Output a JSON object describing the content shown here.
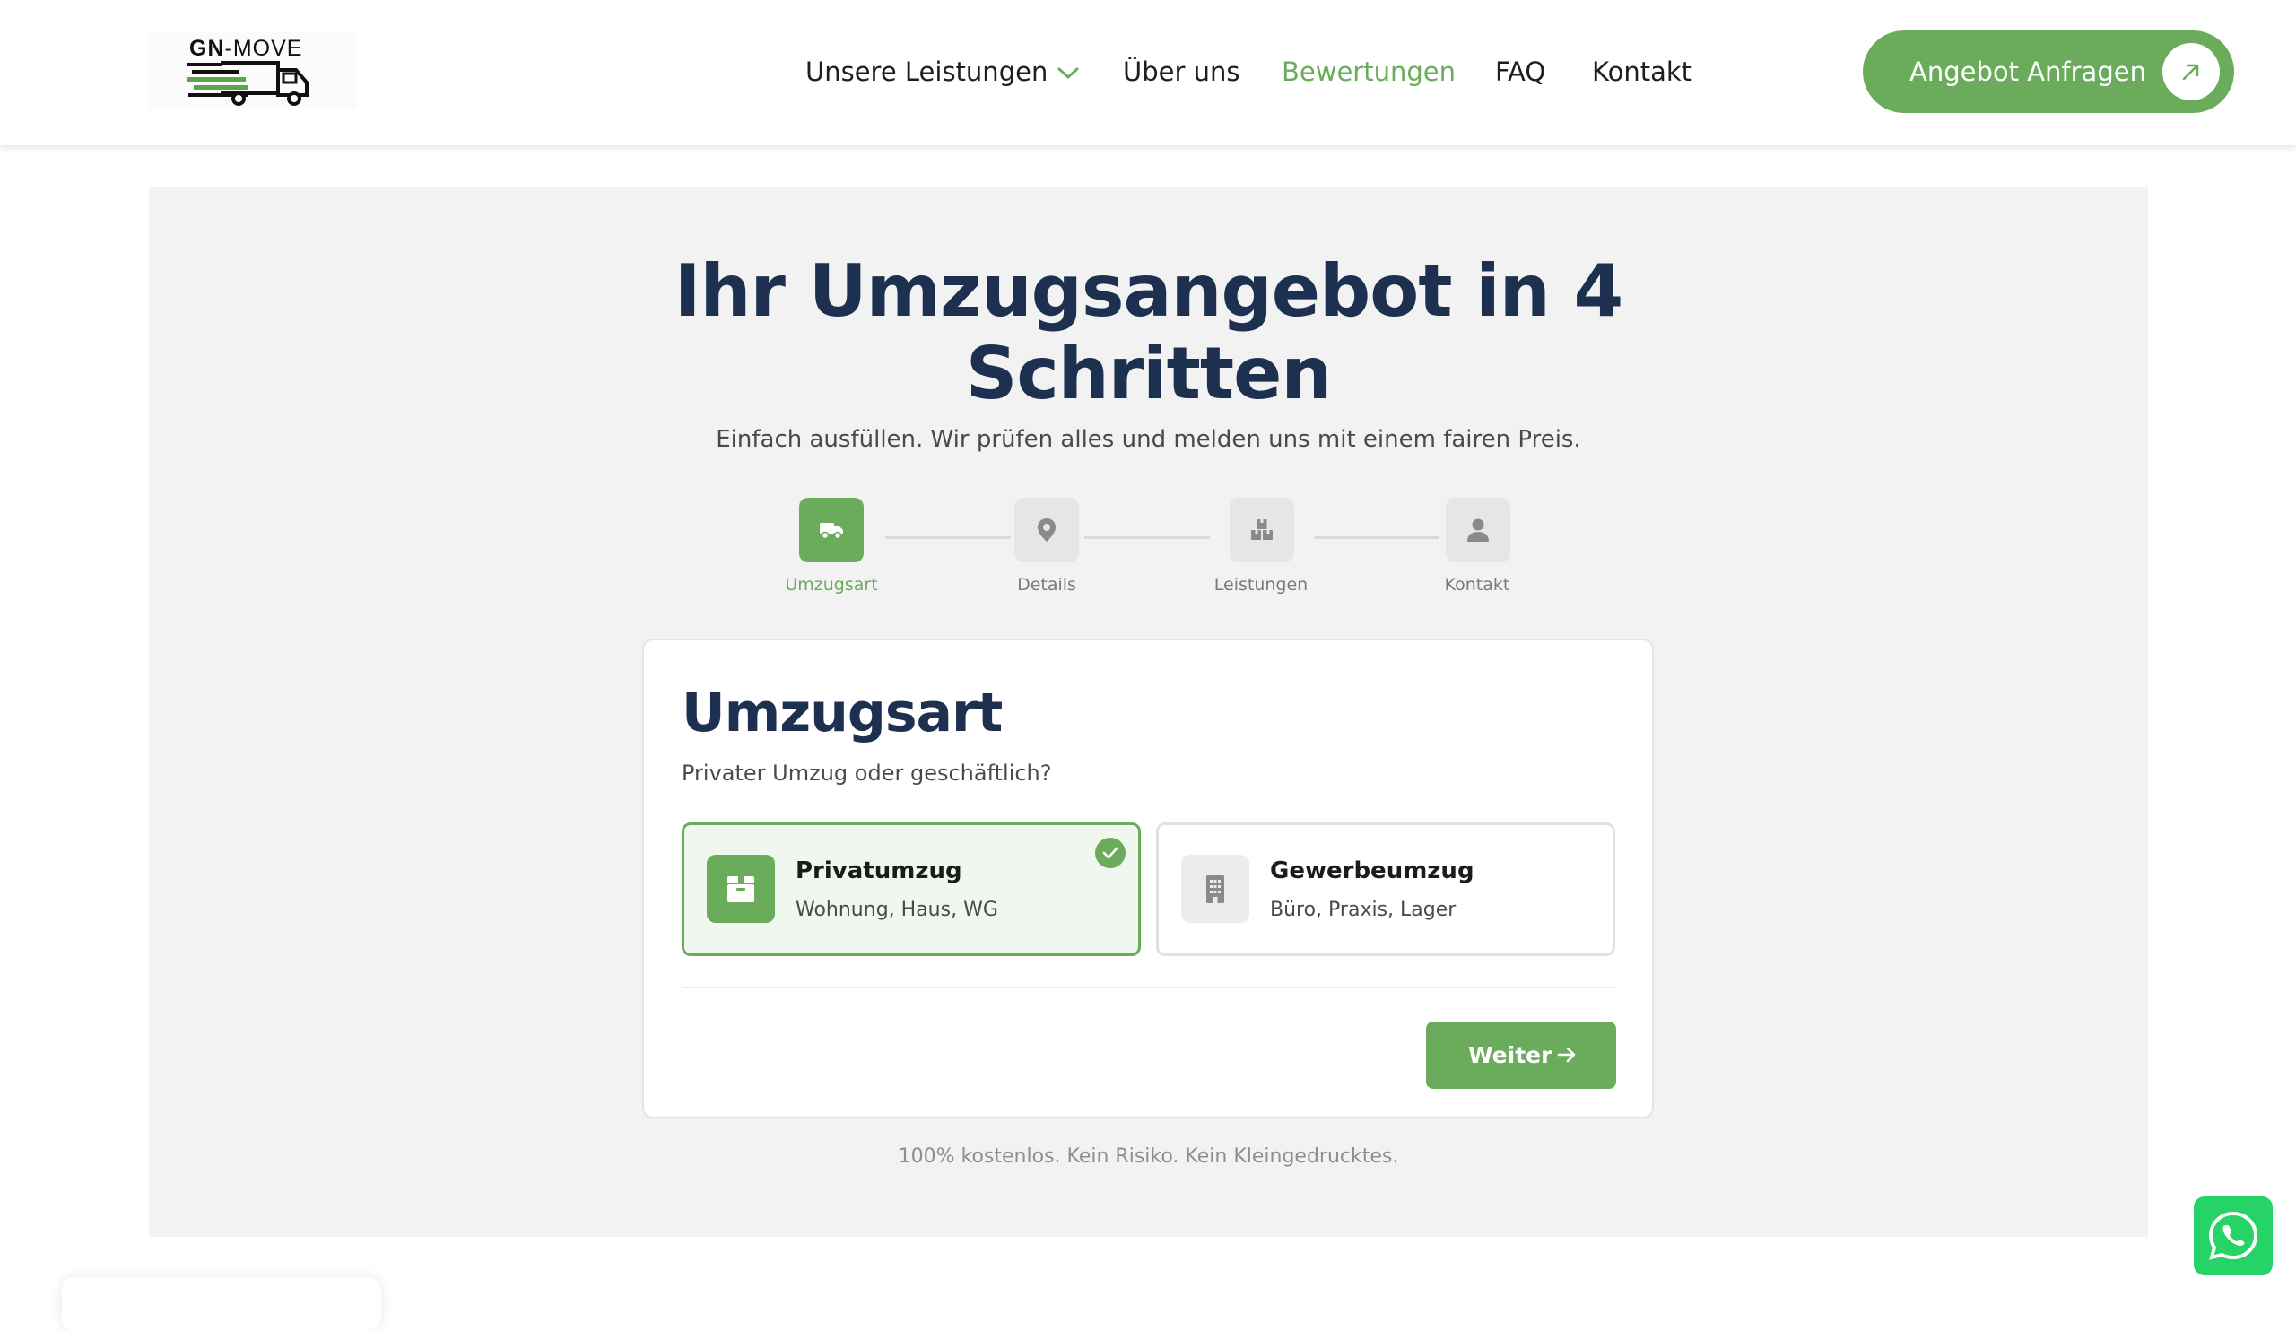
{
  "header": {
    "logo_text_bold": "GN",
    "logo_text_rest": "-MOVE",
    "nav": [
      {
        "label": "Unsere Leistungen",
        "icon": "chevron-down-icon"
      },
      {
        "label": "Über uns"
      },
      {
        "label": "Bewertungen",
        "active": true
      },
      {
        "label": "FAQ"
      },
      {
        "label": "Kontakt"
      }
    ],
    "cta_label": "Angebot Anfragen",
    "cta_icon": "arrow-up-right-icon"
  },
  "hero": {
    "title_line1": "Ihr Umzugsangebot in 4",
    "title_line2": "Schritten",
    "subtitle": "Einfach ausfüllen. Wir prüfen alles und melden uns mit einem fairen Preis."
  },
  "steps": [
    {
      "label": "Umzugsart",
      "icon": "truck-icon",
      "active": true
    },
    {
      "label": "Details",
      "icon": "map-pin-icon",
      "active": false
    },
    {
      "label": "Leistungen",
      "icon": "boxes-icon",
      "active": false
    },
    {
      "label": "Kontakt",
      "icon": "user-icon",
      "active": false
    }
  ],
  "card": {
    "title": "Umzugsart",
    "subtitle": "Privater Umzug oder geschäftlich?",
    "options": [
      {
        "title": "Privatumzug",
        "desc": "Wohnung, Haus, WG",
        "icon": "box-icon",
        "selected": true
      },
      {
        "title": "Gewerbeumzug",
        "desc": "Büro, Praxis, Lager",
        "icon": "building-icon",
        "selected": false
      }
    ],
    "next_label": "Weiter"
  },
  "footnote": "100% kostenlos. Kein Risiko. Kein Kleingedrucktes.",
  "colors": {
    "accent": "#6aac5c",
    "heading": "#1e3050",
    "panel_bg": "#f2f2f2",
    "whatsapp": "#25d366"
  }
}
